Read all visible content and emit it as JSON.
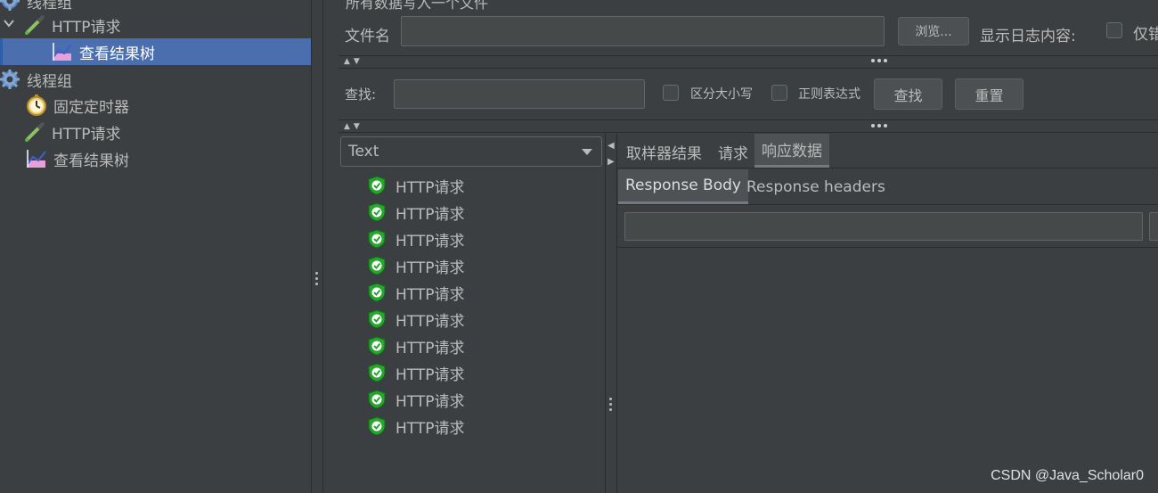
{
  "tree": {
    "items": [
      {
        "label": "线程组"
      },
      {
        "label": "HTTP请求"
      },
      {
        "label": "查看结果树"
      },
      {
        "label": "线程组"
      },
      {
        "label": "固定定时器"
      },
      {
        "label": "HTTP请求"
      },
      {
        "label": "查看结果树"
      }
    ]
  },
  "file_panel": {
    "header": "所有数据写入一个文件",
    "filename_label": "文件名",
    "filename_value": "",
    "browse_button": "浏览...",
    "log_label": "显示日志内容:",
    "only_errors_label": "仅错"
  },
  "search": {
    "label": "查找:",
    "value": "",
    "case_sensitive": "区分大小写",
    "regex": "正则表达式",
    "find_button": "查找",
    "reset_button": "重置"
  },
  "results": {
    "renderer": "Text",
    "items": [
      "HTTP请求",
      "HTTP请求",
      "HTTP请求",
      "HTTP请求",
      "HTTP请求",
      "HTTP请求",
      "HTTP请求",
      "HTTP请求",
      "HTTP请求",
      "HTTP请求"
    ]
  },
  "detail_tabs": {
    "tabs": [
      "取样器结果",
      "请求",
      "响应数据"
    ],
    "active": "响应数据",
    "subtabs": [
      "Response Body",
      "Response headers"
    ],
    "active_subtab": "Response Body"
  },
  "watermark": "CSDN @Java_Scholar0",
  "colors": {
    "background": "#3c3f41",
    "selection": "#4b6eaf",
    "success_shield": "#27a52f"
  }
}
